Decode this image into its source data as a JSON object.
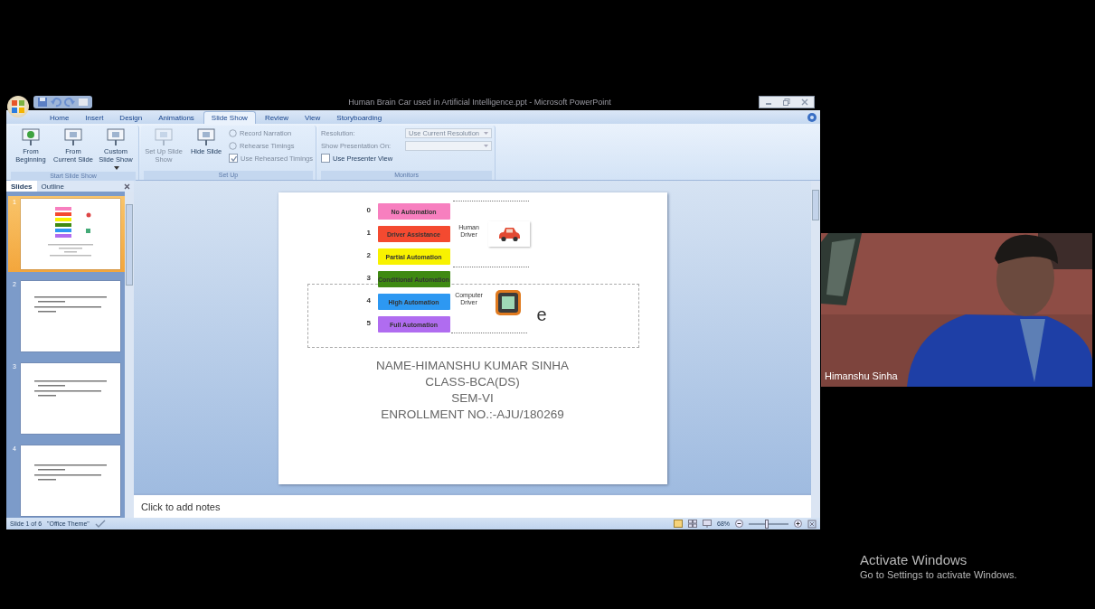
{
  "window": {
    "title": "Human Brain Car used in Artificial Intelligence.ppt - Microsoft PowerPoint"
  },
  "ribbon_tabs": [
    {
      "label": "Home",
      "selected": false
    },
    {
      "label": "Insert",
      "selected": false
    },
    {
      "label": "Design",
      "selected": false
    },
    {
      "label": "Animations",
      "selected": false
    },
    {
      "label": "Slide Show",
      "selected": true
    },
    {
      "label": "Review",
      "selected": false
    },
    {
      "label": "View",
      "selected": false
    },
    {
      "label": "Storyboarding",
      "selected": false
    }
  ],
  "ribbon_groups": [
    {
      "title": "Start Slide Show",
      "items": [
        {
          "kind": "large",
          "label": "From Beginning",
          "disabled": false,
          "dropdown": false
        },
        {
          "kind": "large",
          "label": "From Current Slide",
          "disabled": false,
          "dropdown": false
        },
        {
          "kind": "large",
          "label": "Custom Slide Show",
          "disabled": false,
          "dropdown": true
        }
      ]
    },
    {
      "title": "Set Up",
      "items": [
        {
          "kind": "large",
          "label": "Set Up Slide Show",
          "disabled": true,
          "dropdown": false
        },
        {
          "kind": "large",
          "label": "Hide Slide",
          "disabled": false,
          "dropdown": false
        },
        {
          "kind": "small",
          "label": "Record Narration",
          "disabled": true
        },
        {
          "kind": "small",
          "label": "Rehearse Timings",
          "disabled": true
        },
        {
          "kind": "checkbox",
          "label": "Use Rehearsed Timings",
          "checked": true,
          "disabled": true
        }
      ]
    },
    {
      "title": "Monitors",
      "items": [
        {
          "kind": "select",
          "label": "Resolution:",
          "value": "Use Current Resolution",
          "disabled": true
        },
        {
          "kind": "select",
          "label": "Show Presentation On:",
          "disabled": true
        },
        {
          "kind": "checkbox",
          "label": "Use Presenter View",
          "checked": false,
          "disabled": false
        }
      ]
    }
  ],
  "panel_tabs": [
    {
      "label": "Slides",
      "selected": true
    },
    {
      "label": "Outline",
      "selected": false
    }
  ],
  "thumbnails": [
    {
      "number": "1",
      "kind": "diagram",
      "selected": true
    },
    {
      "number": "2",
      "kind": "bullets",
      "selected": false
    },
    {
      "number": "3",
      "kind": "bullets",
      "selected": false
    },
    {
      "number": "4",
      "kind": "bullets",
      "selected": false
    }
  ],
  "slide": {
    "levels": [
      {
        "number": "0",
        "label": "No Automation",
        "color": "#f77fbf"
      },
      {
        "number": "1",
        "label": "Driver Assistance",
        "color": "#f44a30"
      },
      {
        "number": "2",
        "label": "Partial Automation",
        "color": "#f8f200"
      },
      {
        "number": "3",
        "label": "Conditional Automation",
        "color": "#3f8a12"
      },
      {
        "number": "4",
        "label": "High Automation",
        "color": "#2d98f2"
      },
      {
        "number": "5",
        "label": "Full Automation",
        "color": "#b06cf0"
      }
    ],
    "drivers": [
      {
        "label": "Human Driver",
        "kind": "car"
      },
      {
        "label": "Computer Driver",
        "kind": "chip"
      }
    ],
    "stray_text": "e",
    "lines": [
      "NAME-HIMANSHU KUMAR SINHA",
      "CLASS-BCA(DS)",
      "SEM-VI",
      "ENROLLMENT NO.:-AJU/180269"
    ]
  },
  "notes": {
    "placeholder": "Click to add notes"
  },
  "status_bar": {
    "slide": "Slide 1 of 6",
    "theme": "\"Office Theme\"",
    "zoom": "68%",
    "zoom_level": {
      "level": 0.45
    }
  },
  "video": {
    "name": "Himanshu Sinha"
  },
  "activation": {
    "title": "Activate Windows",
    "message": "Go to Settings to activate Windows."
  }
}
